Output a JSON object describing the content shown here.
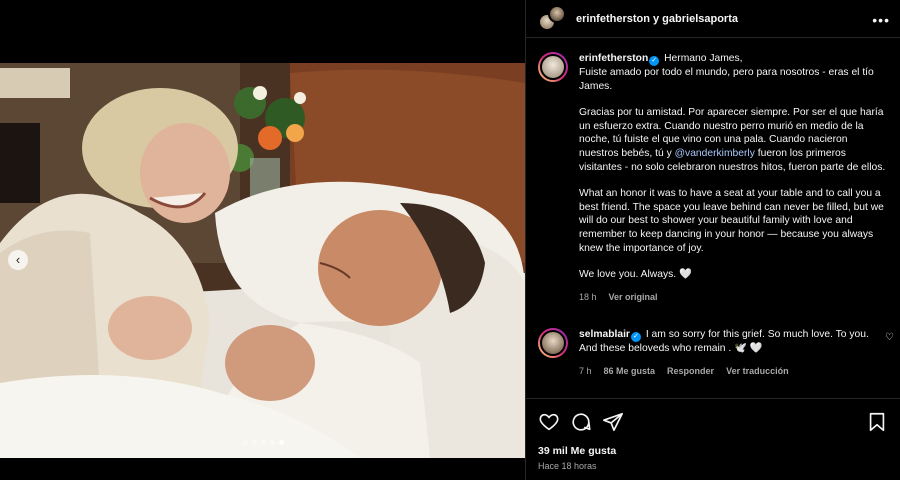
{
  "header": {
    "title": "erinfetherston y gabrielsaporta",
    "more_icon": "more-horizontal-icon"
  },
  "caption": {
    "username": "erinfetherston",
    "line1": "Hermano James,",
    "line2": "Fuiste amado por todo el mundo, pero para nosotros - eras el tío James.",
    "para2_a": "Gracias por tu amistad. Por aparecer siempre. Por ser el que haría un esfuerzo extra. Cuando nuestro perro murió en medio de la noche, tú fuiste el que vino con una pala. Cuando nacieron nuestros bebés, tú y ",
    "mention": "@vanderkimberly",
    "para2_b": " fueron los primeros visitantes - no solo celebraron nuestros hitos, fueron parte de ellos.",
    "para3": "What an honor it was to have a seat at your table and to call you a best friend. The space you leave behind can never be filled, but we will do our best to shower your beautiful family with love and remember to keep dancing in your honor — because you always knew the importance of joy.",
    "para4": "We love you. Always. 🤍",
    "time": "18 h",
    "see_original": "Ver original"
  },
  "comment": {
    "username": "selmablair",
    "text": "I am so sorry for this grief. So much love. To you. And these beloveds who remain . 🕊️ 🤍",
    "time": "7 h",
    "likes": "86 Me gusta",
    "reply": "Responder",
    "translate": "Ver traducción"
  },
  "footer": {
    "likes": "39 mil Me gusta",
    "time": "Hace 18 horas"
  },
  "carousel": {
    "total": 5,
    "active_index": 4
  },
  "colors": {
    "background": "#000000",
    "verified": "#0095f6",
    "muted": "#a8a8a8",
    "mention": "#a8c7fa"
  }
}
